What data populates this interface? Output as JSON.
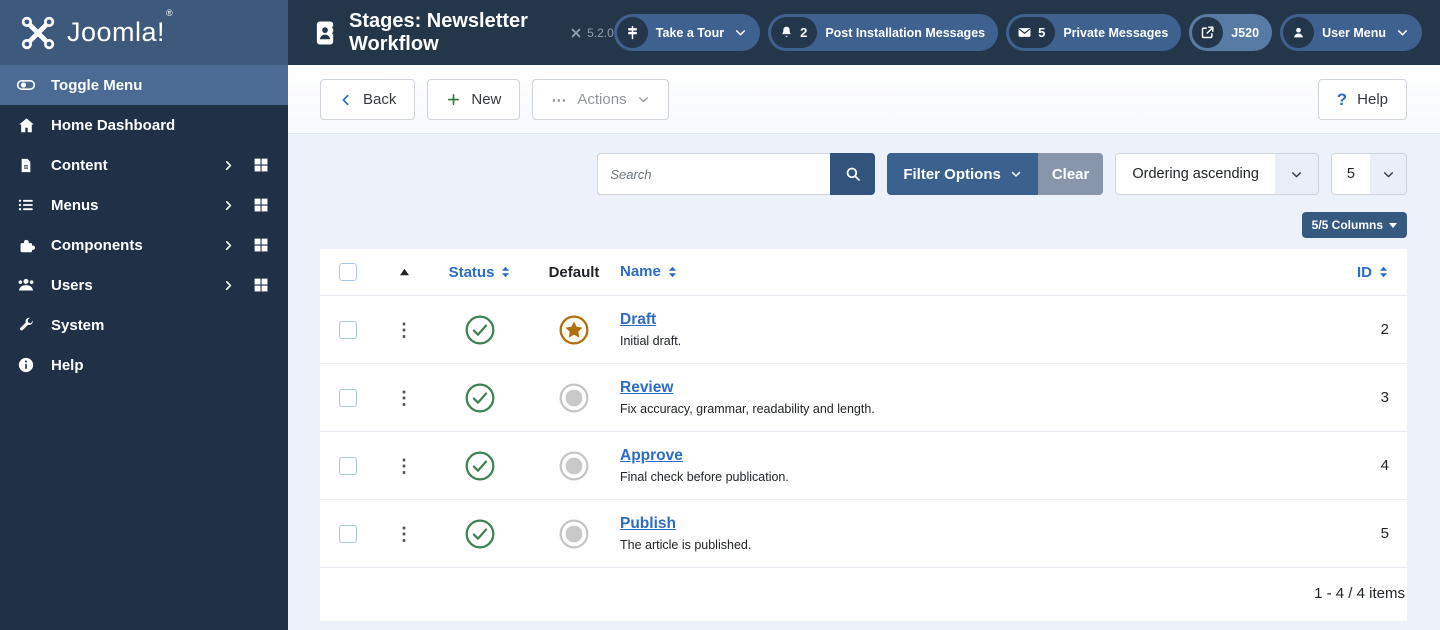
{
  "header": {
    "logo_text": "Joomla!",
    "logo_reg": "®",
    "title": "Stages: Newsletter Workflow",
    "version": "5.2.0",
    "pills": [
      {
        "label": "Take a Tour"
      },
      {
        "count": "2",
        "label": "Post Installation Messages"
      },
      {
        "count": "5",
        "label": "Private Messages"
      },
      {
        "label": "J520"
      },
      {
        "label": "User Menu"
      }
    ]
  },
  "sidebar": {
    "items": [
      {
        "label": "Toggle Menu"
      },
      {
        "label": "Home Dashboard"
      },
      {
        "label": "Content"
      },
      {
        "label": "Menus"
      },
      {
        "label": "Components"
      },
      {
        "label": "Users"
      },
      {
        "label": "System"
      },
      {
        "label": "Help"
      }
    ]
  },
  "toolbar": {
    "back_label": "Back",
    "new_label": "New",
    "actions_label": "Actions",
    "help_label": "Help"
  },
  "filters": {
    "search_placeholder": "Search",
    "filter_options_label": "Filter Options",
    "clear_label": "Clear",
    "ordering_value": "Ordering ascending",
    "limit_value": "5",
    "columns_label": "5/5 Columns"
  },
  "table": {
    "headers": {
      "status": "Status",
      "default": "Default",
      "name": "Name",
      "id": "ID"
    },
    "rows": [
      {
        "name": "Draft",
        "description": "Initial draft.",
        "id": "2",
        "status": "published",
        "default": true
      },
      {
        "name": "Review",
        "description": "Fix accuracy, grammar, readability and length.",
        "id": "3",
        "status": "published",
        "default": false
      },
      {
        "name": "Approve",
        "description": "Final check before publication.",
        "id": "4",
        "status": "published",
        "default": false
      },
      {
        "name": "Publish",
        "description": "The article is published.",
        "id": "5",
        "status": "published",
        "default": false
      }
    ],
    "footer_count": "1 - 4 / 4 items"
  },
  "icons": {
    "drag_handle": "⋮",
    "actions_ellipsis": "⋯"
  },
  "colors": {
    "header_bg": "#243649",
    "brand_bg": "#3d5a7d",
    "sidebar_bg": "#1f3047",
    "sidebar_active_bg": "#4b6b94",
    "pill_bg": "#3f6190",
    "pill_light_bg": "#587ba6",
    "primary_button": "#3b618e",
    "clear_button": "#8796ab",
    "columns_button": "#35597f",
    "content_bg": "#edf1f9",
    "link": "#2e6bc4",
    "success_green": "#3f8254",
    "featured_star": "#b0700e",
    "unset_gray": "#c8c8c8"
  }
}
